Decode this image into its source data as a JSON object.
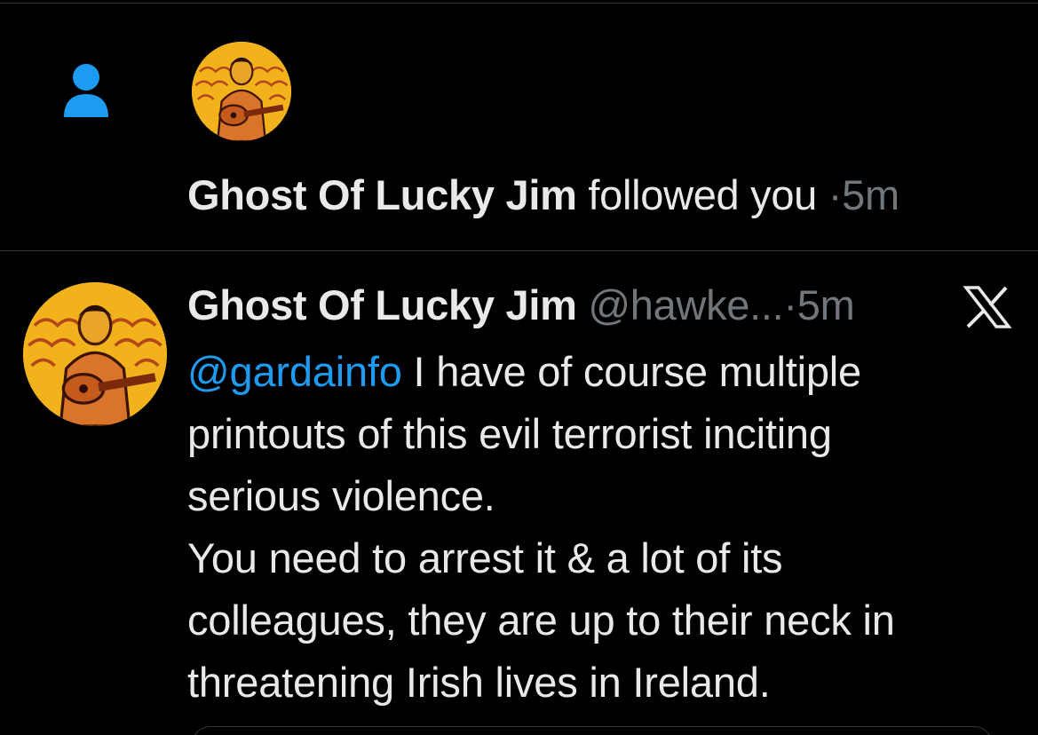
{
  "follow_notification": {
    "icon": "person-icon",
    "user_name": "Ghost Of Lucky Jim",
    "action": "followed you",
    "separator": "·",
    "time": "5m"
  },
  "reply": {
    "user_name": "Ghost Of Lucky Jim",
    "handle": "@hawke...",
    "separator": "·",
    "time": "5m",
    "logo": "x-logo-icon",
    "mention": "@gardainfo",
    "lines": [
      " I have of course multiple",
      "printouts of this evil terrorist inciting",
      "serious violence.",
      "You need to arrest it & a lot of its",
      "colleagues, they are up to their neck in",
      "threatening Irish lives in Ireland."
    ]
  },
  "colors": {
    "background": "#000000",
    "text": "#e7e9ea",
    "muted": "#71767b",
    "accent": "#1d9bf0",
    "divider": "#2f3336"
  }
}
